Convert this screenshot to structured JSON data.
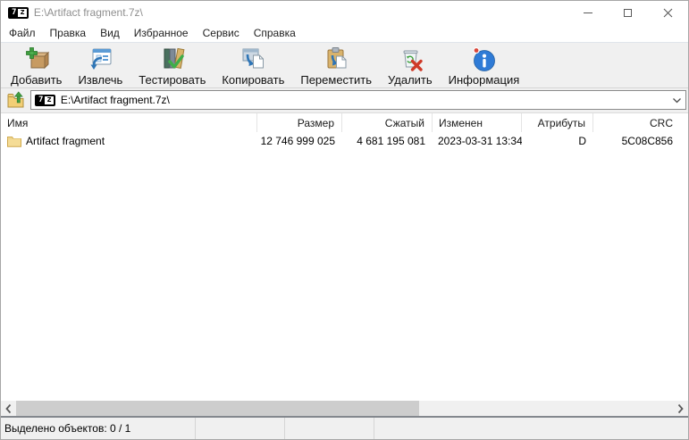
{
  "window": {
    "title": "E:\\Artifact fragment.7z\\"
  },
  "app_badge": {
    "left": "7",
    "right": "z"
  },
  "menu": {
    "items": [
      "Файл",
      "Правка",
      "Вид",
      "Избранное",
      "Сервис",
      "Справка"
    ]
  },
  "toolbar": {
    "buttons": [
      {
        "label": "Добавить",
        "icon": "add-archive-icon"
      },
      {
        "label": "Извлечь",
        "icon": "extract-icon"
      },
      {
        "label": "Тестировать",
        "icon": "test-icon"
      },
      {
        "label": "Копировать",
        "icon": "copy-icon"
      },
      {
        "label": "Переместить",
        "icon": "move-icon"
      },
      {
        "label": "Удалить",
        "icon": "delete-icon"
      },
      {
        "label": "Информация",
        "icon": "info-icon"
      }
    ]
  },
  "address": {
    "value": "E:\\Artifact fragment.7z\\",
    "icon": "7z-badge",
    "up_icon": "folder-up-icon"
  },
  "table": {
    "columns": [
      {
        "label": "Имя",
        "align": "left"
      },
      {
        "label": "Размер",
        "align": "right"
      },
      {
        "label": "Сжатый",
        "align": "right"
      },
      {
        "label": "Изменен",
        "align": "left"
      },
      {
        "label": "Атрибуты",
        "align": "right"
      },
      {
        "label": "CRC",
        "align": "right"
      }
    ],
    "rows": [
      {
        "icon": "folder-icon",
        "name": "Artifact fragment",
        "size": "12 746 999 025",
        "packed": "4 681 195 081",
        "modified": "2023-03-31 13:34",
        "attributes": "D",
        "crc": "5C08C856"
      }
    ]
  },
  "statusbar": {
    "selected_text": "Выделено объектов: 0 / 1"
  },
  "colors": {
    "info_blue": "#2f7bd6",
    "arrow_blue": "#2e75b6",
    "add_green": "#3f9e3f",
    "delete_red": "#cf3a28",
    "folder_yellow": "#f5dc96"
  }
}
